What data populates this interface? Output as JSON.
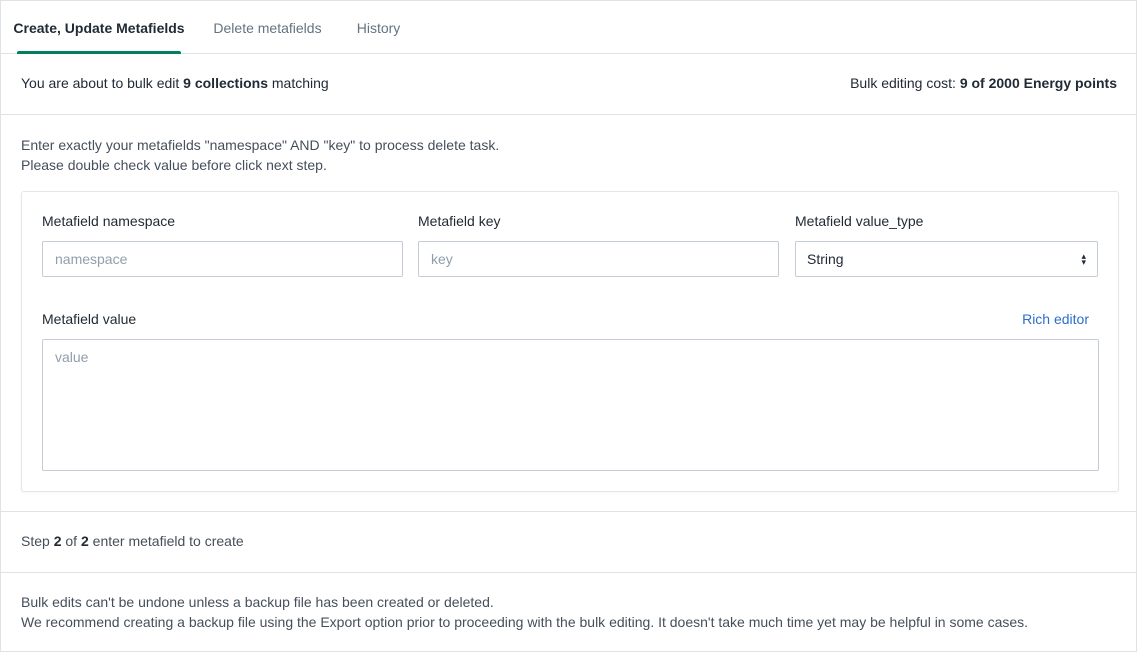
{
  "tabs": [
    {
      "label": "Create, Update Metafields",
      "active": true
    },
    {
      "label": "Delete metafields",
      "active": false
    },
    {
      "label": "History",
      "active": false
    }
  ],
  "bulk": {
    "prefix": "You are about to bulk edit ",
    "count": "9 collections",
    "suffix": " matching",
    "cost_label": "Bulk editing cost: ",
    "cost_value": "9 of 2000 Energy points"
  },
  "instructions": {
    "line1": "Enter exactly your metafields \"namespace\" AND \"key\" to process delete task.",
    "line2": "Please double check value before click next step."
  },
  "form": {
    "namespace_label": "Metafield namespace",
    "namespace_placeholder": "namespace",
    "key_label": "Metafield key",
    "key_placeholder": "key",
    "type_label": "Metafield value_type",
    "type_value": "String",
    "value_label": "Metafield value",
    "value_placeholder": "value",
    "rich_editor": "Rich editor"
  },
  "step": {
    "word": "Step ",
    "current": "2",
    "of": " of ",
    "total": "2",
    "description": " enter metafield to create"
  },
  "note": {
    "line1": "Bulk edits can't be undone unless a backup file has been created or deleted.",
    "line2": "We recommend creating a backup file using the Export option prior to proceeding with the bulk editing. It doesn't take much time yet may be helpful in some cases."
  },
  "colors": {
    "accent": "#008060",
    "link": "#2c6ecb",
    "border": "#dfe3e8"
  }
}
